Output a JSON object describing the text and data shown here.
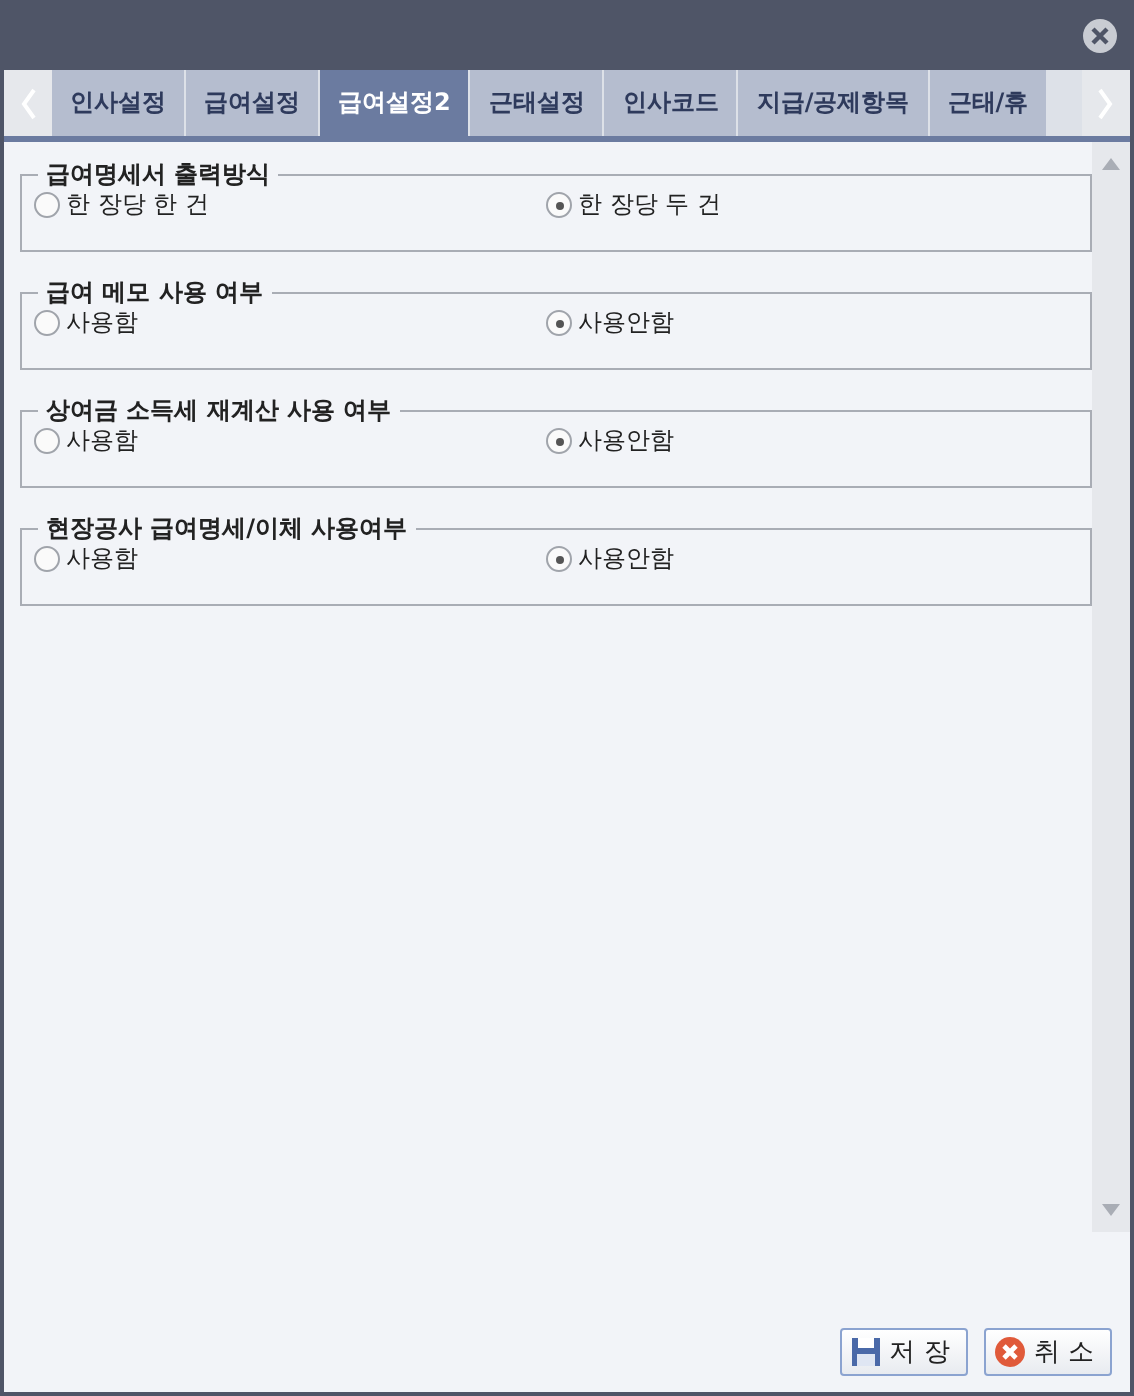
{
  "tabs": [
    {
      "label": "인사설정",
      "selected": false
    },
    {
      "label": "급여설정",
      "selected": false
    },
    {
      "label": "급여설정2",
      "selected": true
    },
    {
      "label": "근태설정",
      "selected": false
    },
    {
      "label": "인사코드",
      "selected": false
    },
    {
      "label": "지급/공제항목",
      "selected": false
    },
    {
      "label": "근태/휴",
      "selected": false
    }
  ],
  "groups": [
    {
      "title": "급여명세서 출력방식",
      "options": [
        {
          "label": "한 장당 한 건",
          "selected": false
        },
        {
          "label": "한 장당 두 건",
          "selected": true
        }
      ]
    },
    {
      "title": "급여 메모 사용 여부",
      "options": [
        {
          "label": "사용함",
          "selected": false
        },
        {
          "label": "사용안함",
          "selected": true
        }
      ]
    },
    {
      "title": "상여금 소득세 재계산 사용 여부",
      "options": [
        {
          "label": "사용함",
          "selected": false
        },
        {
          "label": "사용안함",
          "selected": true
        }
      ]
    },
    {
      "title": "현장공사 급여명세/이체 사용여부",
      "options": [
        {
          "label": "사용함",
          "selected": false
        },
        {
          "label": "사용안함",
          "selected": true
        }
      ]
    }
  ],
  "buttons": [
    {
      "label": "저 장",
      "kind": "save"
    },
    {
      "label": "취 소",
      "kind": "cancel"
    }
  ]
}
